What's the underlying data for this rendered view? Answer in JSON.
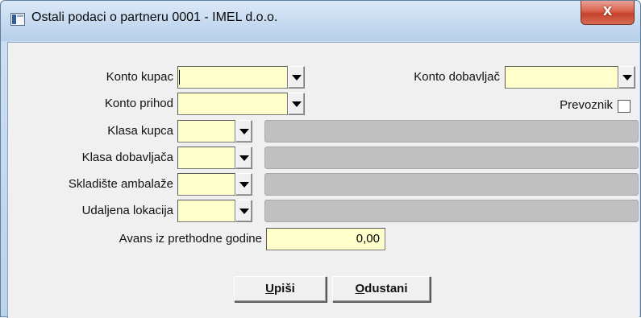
{
  "window": {
    "title": "Ostali podaci o partneru 0001 - IMEL d.o.o.",
    "close_label": "X"
  },
  "form": {
    "konto_kupac_label": "Konto kupac",
    "konto_kupac_value": "",
    "konto_dobavljac_label": "Konto dobavljač",
    "konto_dobavljac_value": "",
    "konto_prihod_label": "Konto prihod",
    "konto_prihod_value": "",
    "prevoznik_label": "Prevoznik",
    "prevoznik_checked": false,
    "klasa_kupca_label": "Klasa kupca",
    "klasa_kupca_value": "",
    "klasa_dobavljaca_label": "Klasa dobavljača",
    "klasa_dobavljaca_value": "",
    "skladiste_ambalaze_label": "Skladište ambalaže",
    "skladiste_ambalaze_value": "",
    "udaljena_lokacija_label": "Udaljena lokacija",
    "udaljena_lokacija_value": "",
    "avans_label": "Avans iz prethodne godine",
    "avans_value": "0,00"
  },
  "buttons": {
    "upisi_mnemonic": "U",
    "upisi_rest": "piši",
    "odustani_mnemonic": "O",
    "odustani_rest": "dustani"
  },
  "colors": {
    "field_bg": "#ffffcc",
    "disabled_bg": "#c0c0c0",
    "dialog_bg": "#f0f0f0"
  }
}
